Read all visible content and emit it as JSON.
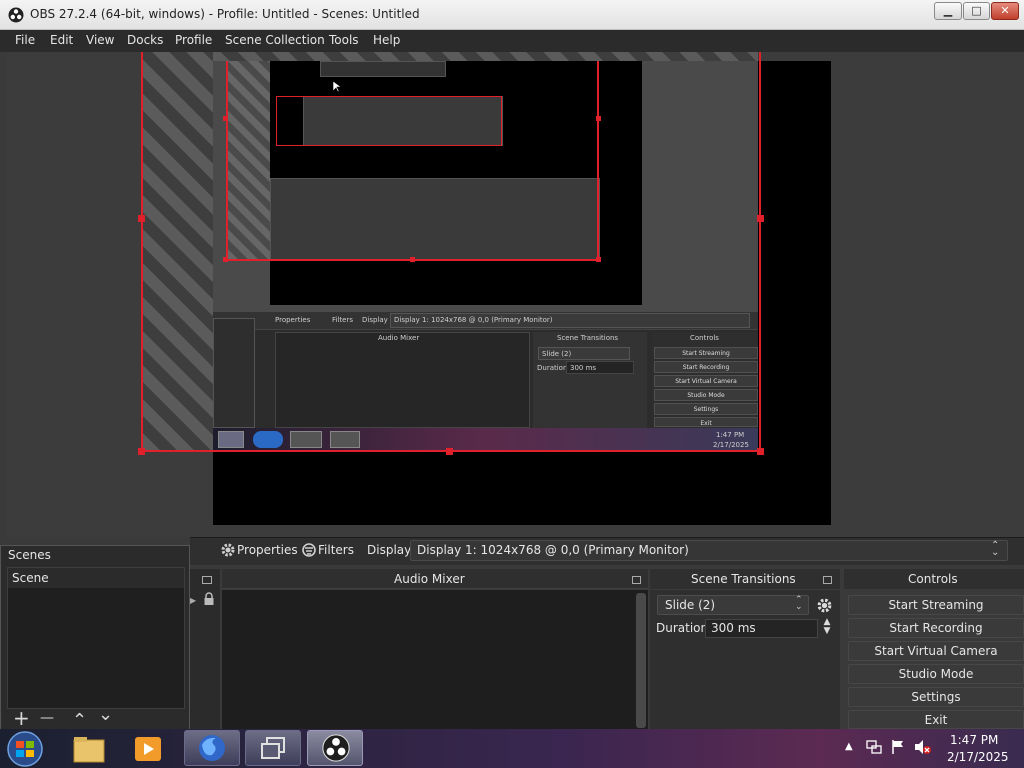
{
  "window": {
    "title": "OBS 27.2.4 (64-bit, windows) - Profile: Untitled - Scenes: Untitled",
    "minimize": "▁",
    "maximize": "□",
    "close": "✕"
  },
  "menu": [
    "File",
    "Edit",
    "View",
    "Docks",
    "Profile",
    "Scene Collection",
    "Tools",
    "Help"
  ],
  "dock_toolbar": {
    "properties": "Properties",
    "filters": "Filters",
    "display_label": "Display",
    "display_value": "Display 1: 1024x768 @ 0,0 (Primary Monitor)"
  },
  "scenes": {
    "title": "Scenes",
    "items": [
      "Scene"
    ],
    "add": "+",
    "remove": "—",
    "up": "⌃",
    "down": "⌄"
  },
  "mixer": {
    "title": "Audio Mixer"
  },
  "transitions": {
    "title": "Scene Transitions",
    "selected": "Slide (2)",
    "duration_label": "Duration",
    "duration_value": "300 ms"
  },
  "controls": {
    "title": "Controls",
    "buttons": [
      "Start Streaming",
      "Start Recording",
      "Start Virtual Camera",
      "Studio Mode",
      "Settings",
      "Exit"
    ]
  },
  "nested_preview": {
    "properties": "Properties",
    "filters": "Filters",
    "display_label": "Display",
    "display_value": "Display 1: 1024x768 @ 0,0 (Primary Monitor)",
    "mixer_title": "Audio Mixer",
    "transitions_title": "Scene Transitions",
    "transition_selected": "Slide (2)",
    "duration_label": "Duration",
    "duration_value": "300 ms",
    "controls_title": "Controls",
    "buttons": [
      "Start Streaming",
      "Start Recording",
      "Start Virtual Camera",
      "Studio Mode",
      "Settings",
      "Exit"
    ],
    "time": "1:47 PM",
    "date": "2/17/2025"
  },
  "taskbar": {
    "time": "1:47 PM",
    "date": "2/17/2025",
    "apps": [
      "start-orb",
      "file-explorer",
      "media-player",
      "firefox",
      "task-view",
      "obs-studio"
    ]
  },
  "colors": {
    "selection": "#e0202a",
    "background": "#3a3a3a"
  }
}
